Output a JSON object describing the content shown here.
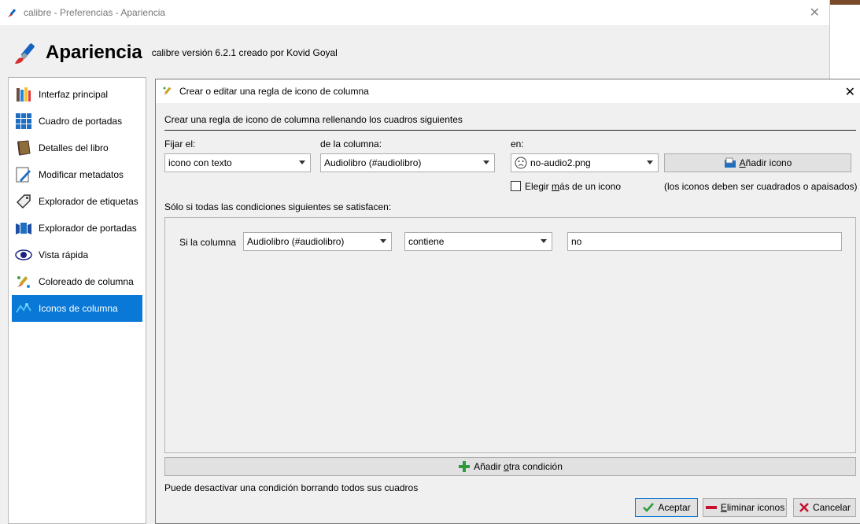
{
  "window": {
    "title": "calibre - Preferencias - Apariencia",
    "heading": "Apariencia",
    "version": "calibre versión 6.2.1 creado por Kovid Goyal"
  },
  "sidebar": {
    "items": [
      {
        "label": "Interfaz principal",
        "icon": "books-icon"
      },
      {
        "label": "Cuadro de portadas",
        "icon": "grid-icon"
      },
      {
        "label": "Detalles del libro",
        "icon": "book-icon"
      },
      {
        "label": "Modificar metadatos",
        "icon": "edit-icon"
      },
      {
        "label": "Explorador de etiquetas",
        "icon": "tag-icon"
      },
      {
        "label": "Explorador de portadas",
        "icon": "covers-icon"
      },
      {
        "label": "Vista rápida",
        "icon": "eye-icon"
      },
      {
        "label": "Coloreado de columna",
        "icon": "palette-icon"
      },
      {
        "label": "Iconos de columna",
        "icon": "column-icons-icon",
        "active": true
      }
    ]
  },
  "dialog": {
    "title": "Crear o editar una regla de icono de columna",
    "intro": "Crear una regla de icono de columna rellenando los cuadros siguientes",
    "set_label": "Fijar el:",
    "set_value": "icono con texto",
    "column_label": "de la columna:",
    "column_value": "Audiolibro (#audiolibro)",
    "in_label": "en:",
    "icon_value": "no-audio2.png",
    "add_icon_pre": "",
    "add_icon_u": "A",
    "add_icon_post": "ñadir icono",
    "multi_pre": "Elegir ",
    "multi_u": "m",
    "multi_post": "ás de un icono",
    "icons_note": "(los iconos deben ser cuadrados o apaisados)",
    "conditions_label": "Sólo si todas las condiciones siguientes se satisfacen:",
    "condition": {
      "prefix": "Si la columna",
      "column": "Audiolibro (#audiolibro)",
      "operator": "contiene",
      "value": "no"
    },
    "add_condition_pre": "Añadir ",
    "add_condition_u": "o",
    "add_condition_post": "tra condición",
    "hint": "Puede desactivar una condición borrando todos sus cuadros",
    "ok_label": "Aceptar",
    "remove_u": "E",
    "remove_post": "liminar iconos",
    "cancel_label": "Cancelar"
  },
  "colors": {
    "accent": "#0a78d7",
    "ok": "#2e9a3e",
    "remove": "#c8102e",
    "add": "#2e9a3e"
  }
}
